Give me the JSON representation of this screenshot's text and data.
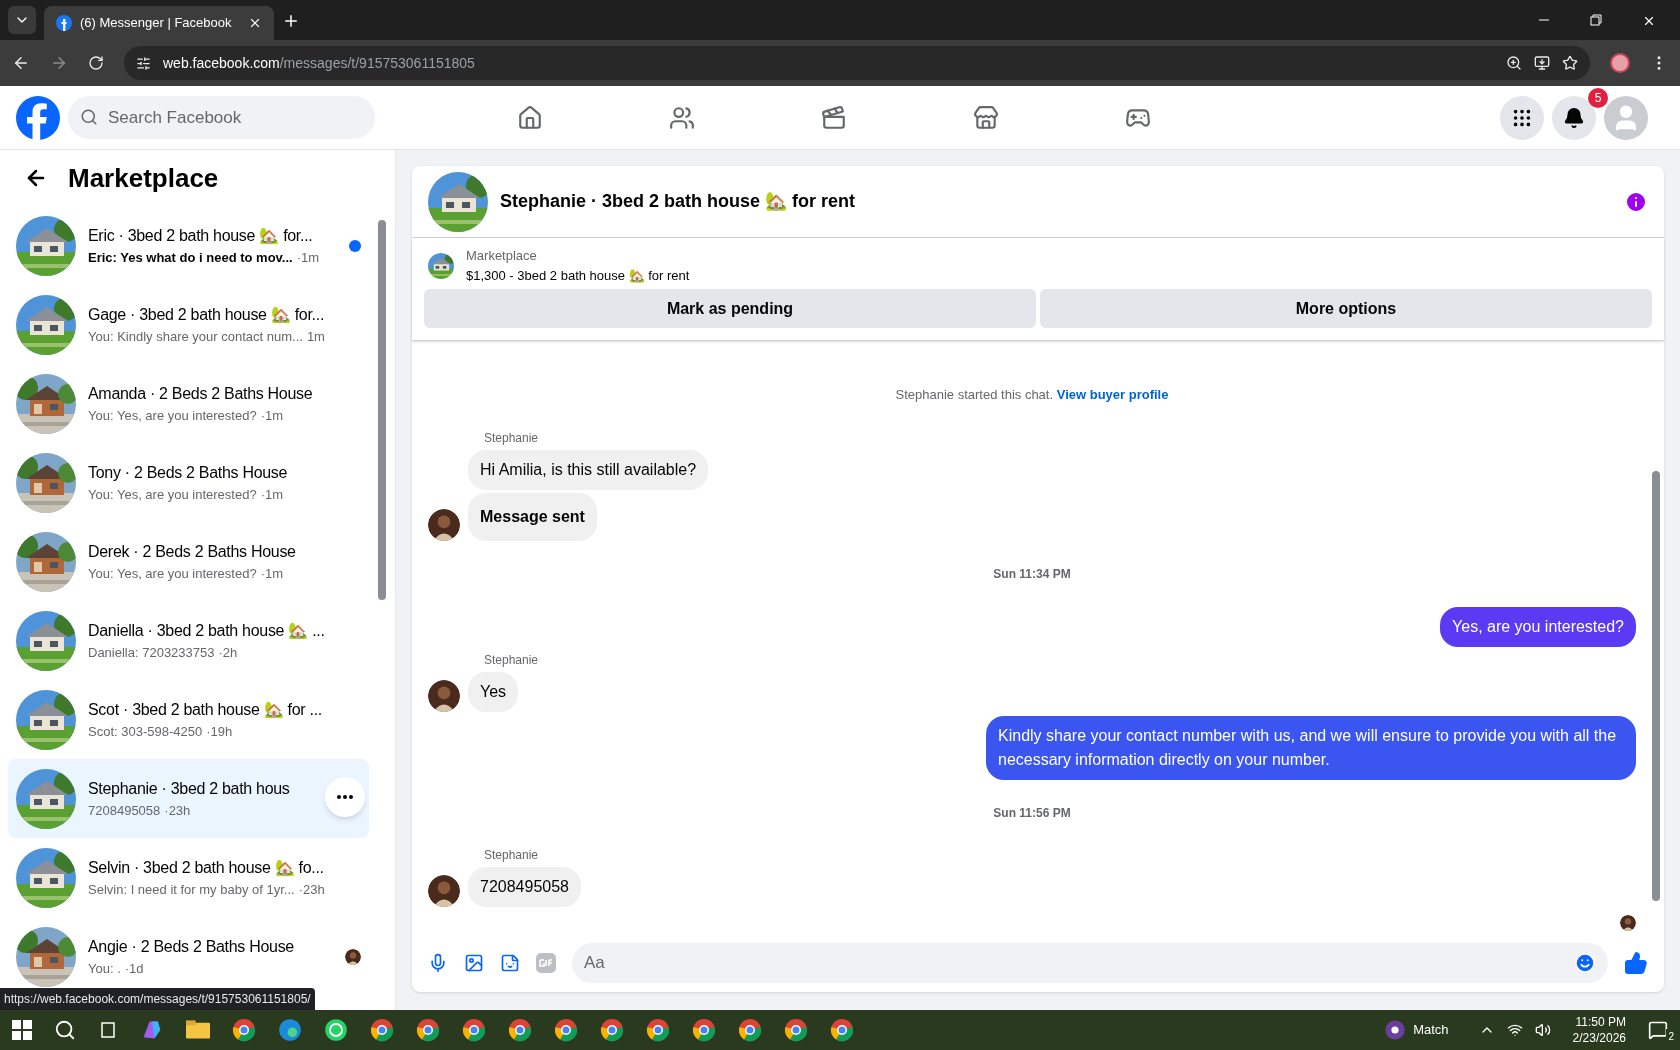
{
  "browser": {
    "tab_title": "(6) Messenger | Facebook",
    "url_host": "web.facebook.com",
    "url_path": "/messages/t/915753061151805"
  },
  "header": {
    "search_placeholder": "Search Facebook",
    "notification_count": "5"
  },
  "sidebar": {
    "title": "Marketplace",
    "conversations": [
      {
        "title": "Eric · 3bed 2 bath house 🏡 for...",
        "preview": "Eric: Yes what do i need to mov...",
        "time": "·1m",
        "unread": true,
        "selected": false,
        "seen": false,
        "kind": "cottage"
      },
      {
        "title": "Gage · 3bed 2 bath house 🏡 for...",
        "preview": "You: Kindly share your contact num...",
        "time": "1m",
        "unread": false,
        "selected": false,
        "seen": false,
        "kind": "cottage"
      },
      {
        "title": "Amanda · 2 Beds 2 Baths House",
        "preview": "You: Yes, are you interested?",
        "time": "·1m",
        "unread": false,
        "selected": false,
        "seen": false,
        "kind": "ranch"
      },
      {
        "title": "Tony · 2 Beds 2 Baths House",
        "preview": "You: Yes, are you interested?",
        "time": "·1m",
        "unread": false,
        "selected": false,
        "seen": false,
        "kind": "ranch"
      },
      {
        "title": "Derek · 2 Beds 2 Baths House",
        "preview": "You: Yes, are you interested?",
        "time": "·1m",
        "unread": false,
        "selected": false,
        "seen": false,
        "kind": "ranch"
      },
      {
        "title": "Daniella · 3bed 2 bath house 🏡 ...",
        "preview": "Daniella: 7203233753",
        "time": "·2h",
        "unread": false,
        "selected": false,
        "seen": false,
        "kind": "cottage"
      },
      {
        "title": "Scot · 3bed 2 bath house 🏡 for ...",
        "preview": "Scot: 303-598-4250",
        "time": "·19h",
        "unread": false,
        "selected": false,
        "seen": false,
        "kind": "cottage"
      },
      {
        "title": "Stephanie · 3bed 2 bath hous",
        "preview": "7208495058",
        "time": "·23h",
        "unread": false,
        "selected": true,
        "seen": false,
        "kind": "cottage"
      },
      {
        "title": "Selvin · 3bed 2 bath house 🏡 fo...",
        "preview": "Selvin: I need it for my baby of 1yr...",
        "time": "·23h",
        "unread": false,
        "selected": false,
        "seen": false,
        "kind": "cottage"
      },
      {
        "title": "Angie · 2 Beds 2 Baths House",
        "preview": "You: .",
        "time": "·1d",
        "unread": false,
        "selected": false,
        "seen": true,
        "kind": "ranch"
      }
    ]
  },
  "chat": {
    "title": "Stephanie · 3bed 2 bath house 🏡 for rent",
    "listing_label": "Marketplace",
    "listing": "$1,300 - 3bed 2 bath house 🏡 for rent",
    "buttons": [
      "Mark as pending",
      "More options"
    ],
    "messages": [
      {
        "kind": "notice",
        "text": "Stephanie started this chat.",
        "link": "View buyer profile"
      },
      {
        "kind": "incoming",
        "sender": "Stephanie",
        "bubbles": [
          {
            "text": "Hi Amilia, is this still available?",
            "bold": false
          },
          {
            "text": "Message sent",
            "bold": true
          }
        ]
      },
      {
        "kind": "time",
        "text": "Sun 11:34 PM"
      },
      {
        "kind": "outgoing",
        "bubbles": [
          {
            "text": "Yes, are you interested?",
            "color": "#5a3bf3"
          }
        ]
      },
      {
        "kind": "incoming",
        "sender": "Stephanie",
        "bubbles": [
          {
            "text": "Yes",
            "bold": false
          }
        ]
      },
      {
        "kind": "outgoing",
        "bubbles": [
          {
            "text": "Kindly share your contact number with us, and we will ensure to provide you with all the necessary information directly on your number.",
            "color": "#3b55f0"
          }
        ]
      },
      {
        "kind": "time",
        "text": "Sun 11:56 PM"
      },
      {
        "kind": "incoming",
        "sender": "Stephanie",
        "bubbles": [
          {
            "text": "7208495058",
            "bold": false
          }
        ]
      }
    ],
    "composer_placeholder": "Aa"
  },
  "status_url": "https://web.facebook.com/messages/t/915753061151805/",
  "taskbar": {
    "weather": "Match",
    "time": "11:50 PM",
    "date": "2/23/2026",
    "notifications": "2"
  }
}
